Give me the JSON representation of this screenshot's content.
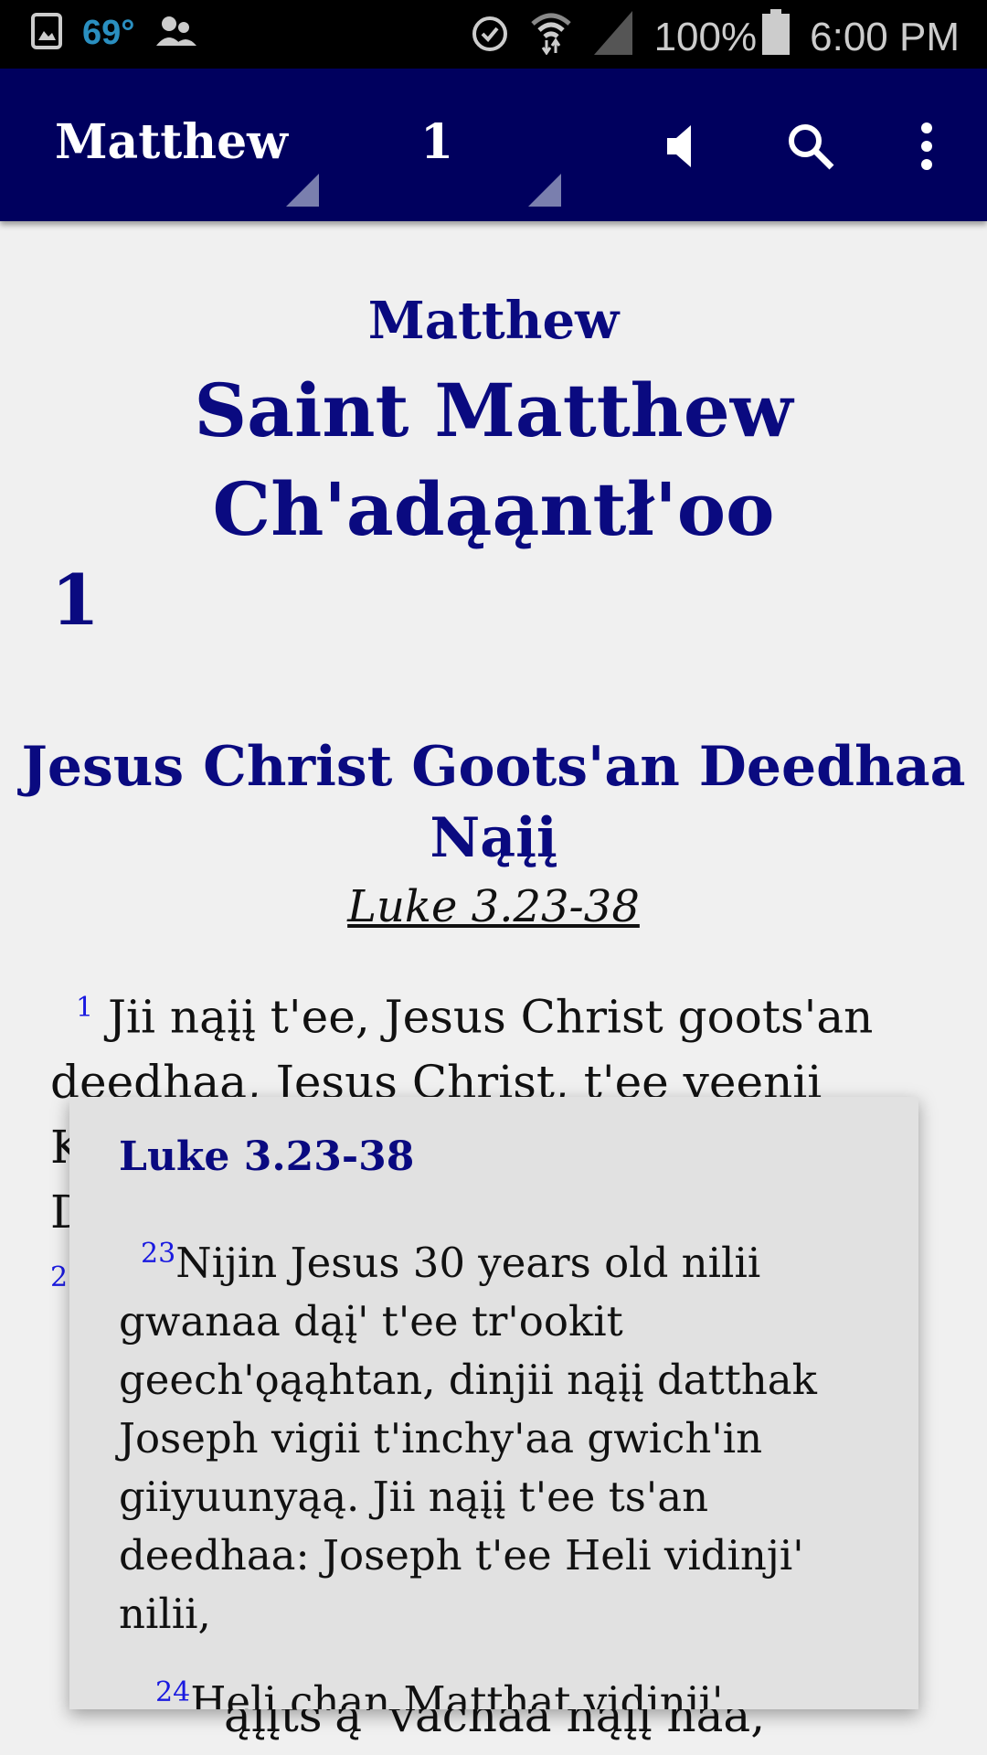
{
  "status_bar": {
    "temperature": "69°",
    "battery": "100%",
    "time": "6:00 PM",
    "icons": [
      "gallery-icon",
      "people-icon",
      "alarm-icon",
      "wifi-icon",
      "signal-icon",
      "battery-icon"
    ]
  },
  "toolbar": {
    "book": "Matthew",
    "chapter": "1",
    "icons": [
      "speaker-icon",
      "search-icon",
      "more-icon"
    ],
    "color": "#00005e"
  },
  "content": {
    "book_short": "Matthew",
    "book_title_1": "Saint Matthew",
    "book_title_2": "Ch'adąąntł'oo",
    "chapter_number": "1",
    "section_heading_1": "Jesus Christ Goots'an Deedhaa",
    "section_heading_2": "Nąįį",
    "cross_reference": "Luke 3.23-38",
    "verse_1_number": "1",
    "verse_1_text": "Jii nąįį t'ee, Jesus Christ goots'an deedhaa, Jesus Christ, t'ee yeenii",
    "hidden_line_3": "K",
    "hidden_line_4": "D",
    "verse_2_number": "2",
    "hidden_bottom_line": "ąįįts'ą' vachaa nąįį haa,"
  },
  "popup": {
    "title": "Luke 3.23-38",
    "verse_23_number": "23",
    "verse_23_text": "Nijin Jesus 30 years old nilii gwanaa dąį' t'ee tr'ookit geech'ǫąąhtan, dinjii nąįį datthak Joseph vigii t'inchy'aa gwich'in giiyuunyąą. Jii nąįį t'ee ts'an deedhaa: Joseph t'ee Heli vidinji' nilii,",
    "verse_24_number": "24",
    "verse_24_text": "Heli chan Matthat vidinji'"
  }
}
